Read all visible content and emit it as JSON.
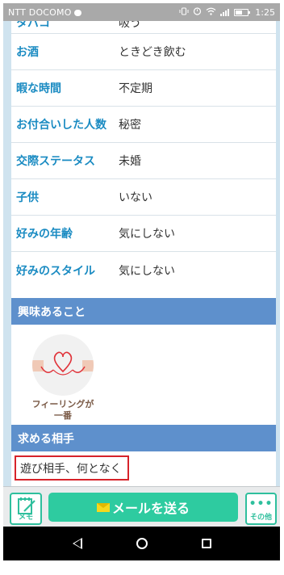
{
  "status_bar": {
    "carrier": "NTT DOCOMO",
    "time": "1:25"
  },
  "profile_rows": [
    {
      "label": "タバコ",
      "value": "吸う"
    },
    {
      "label": "お酒",
      "value": "ときどき飲む"
    },
    {
      "label": "暇な時間",
      "value": "不定期"
    },
    {
      "label": "お付合いした人数",
      "value": "秘密"
    },
    {
      "label": "交際ステータス",
      "value": "未婚"
    },
    {
      "label": "子供",
      "value": "いない"
    },
    {
      "label": "好みの年齢",
      "value": "気にしない"
    },
    {
      "label": "好みのスタイル",
      "value": "気にしない"
    }
  ],
  "sections": {
    "interests": {
      "title": "興味あること",
      "items": [
        {
          "label_line1": "フィーリングが",
          "label_line2": "一番",
          "icon": "heart-thread-icon"
        }
      ]
    },
    "seeking": {
      "title": "求める相手",
      "value": "遊び相手、何となく"
    }
  },
  "action_bar": {
    "memo_label": "メモ",
    "mail_label": "メールを送る",
    "other_label": "その他",
    "other_dots": "•••"
  },
  "colors": {
    "label_blue": "#1a8bc2",
    "section_blue": "#5e90cc",
    "accent_green": "#2ecba0",
    "highlight_red": "#d7232a"
  }
}
